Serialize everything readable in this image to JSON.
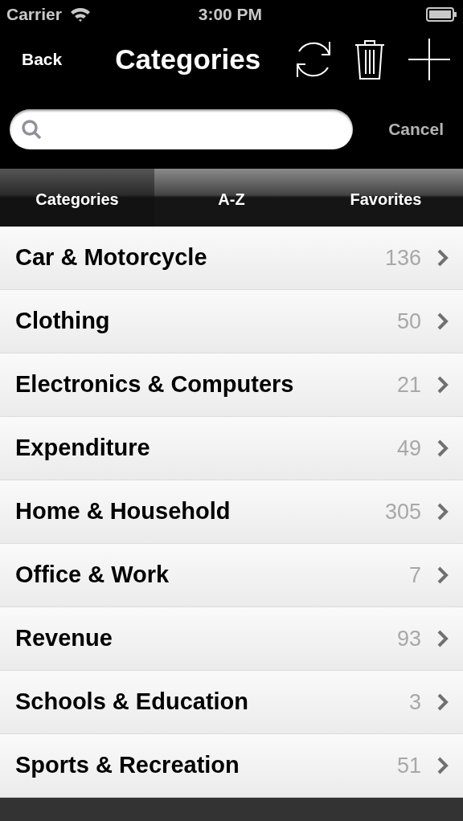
{
  "status_bar": {
    "carrier": "Carrier",
    "time": "3:00 PM"
  },
  "nav_bar": {
    "back": "Back",
    "title": "Categories"
  },
  "search": {
    "cancel": "Cancel"
  },
  "tabs": [
    {
      "label": "Categories",
      "selected": true
    },
    {
      "label": "A-Z",
      "selected": false
    },
    {
      "label": "Favorites",
      "selected": false
    }
  ],
  "categories": [
    {
      "name": "Car & Motorcycle",
      "count": "136"
    },
    {
      "name": "Clothing",
      "count": "50"
    },
    {
      "name": "Electronics & Computers",
      "count": "21"
    },
    {
      "name": "Expenditure",
      "count": "49"
    },
    {
      "name": "Home & Household",
      "count": "305"
    },
    {
      "name": "Office & Work",
      "count": "7"
    },
    {
      "name": "Revenue",
      "count": "93"
    },
    {
      "name": "Schools & Education",
      "count": "3"
    },
    {
      "name": "Sports & Recreation",
      "count": "51"
    }
  ]
}
